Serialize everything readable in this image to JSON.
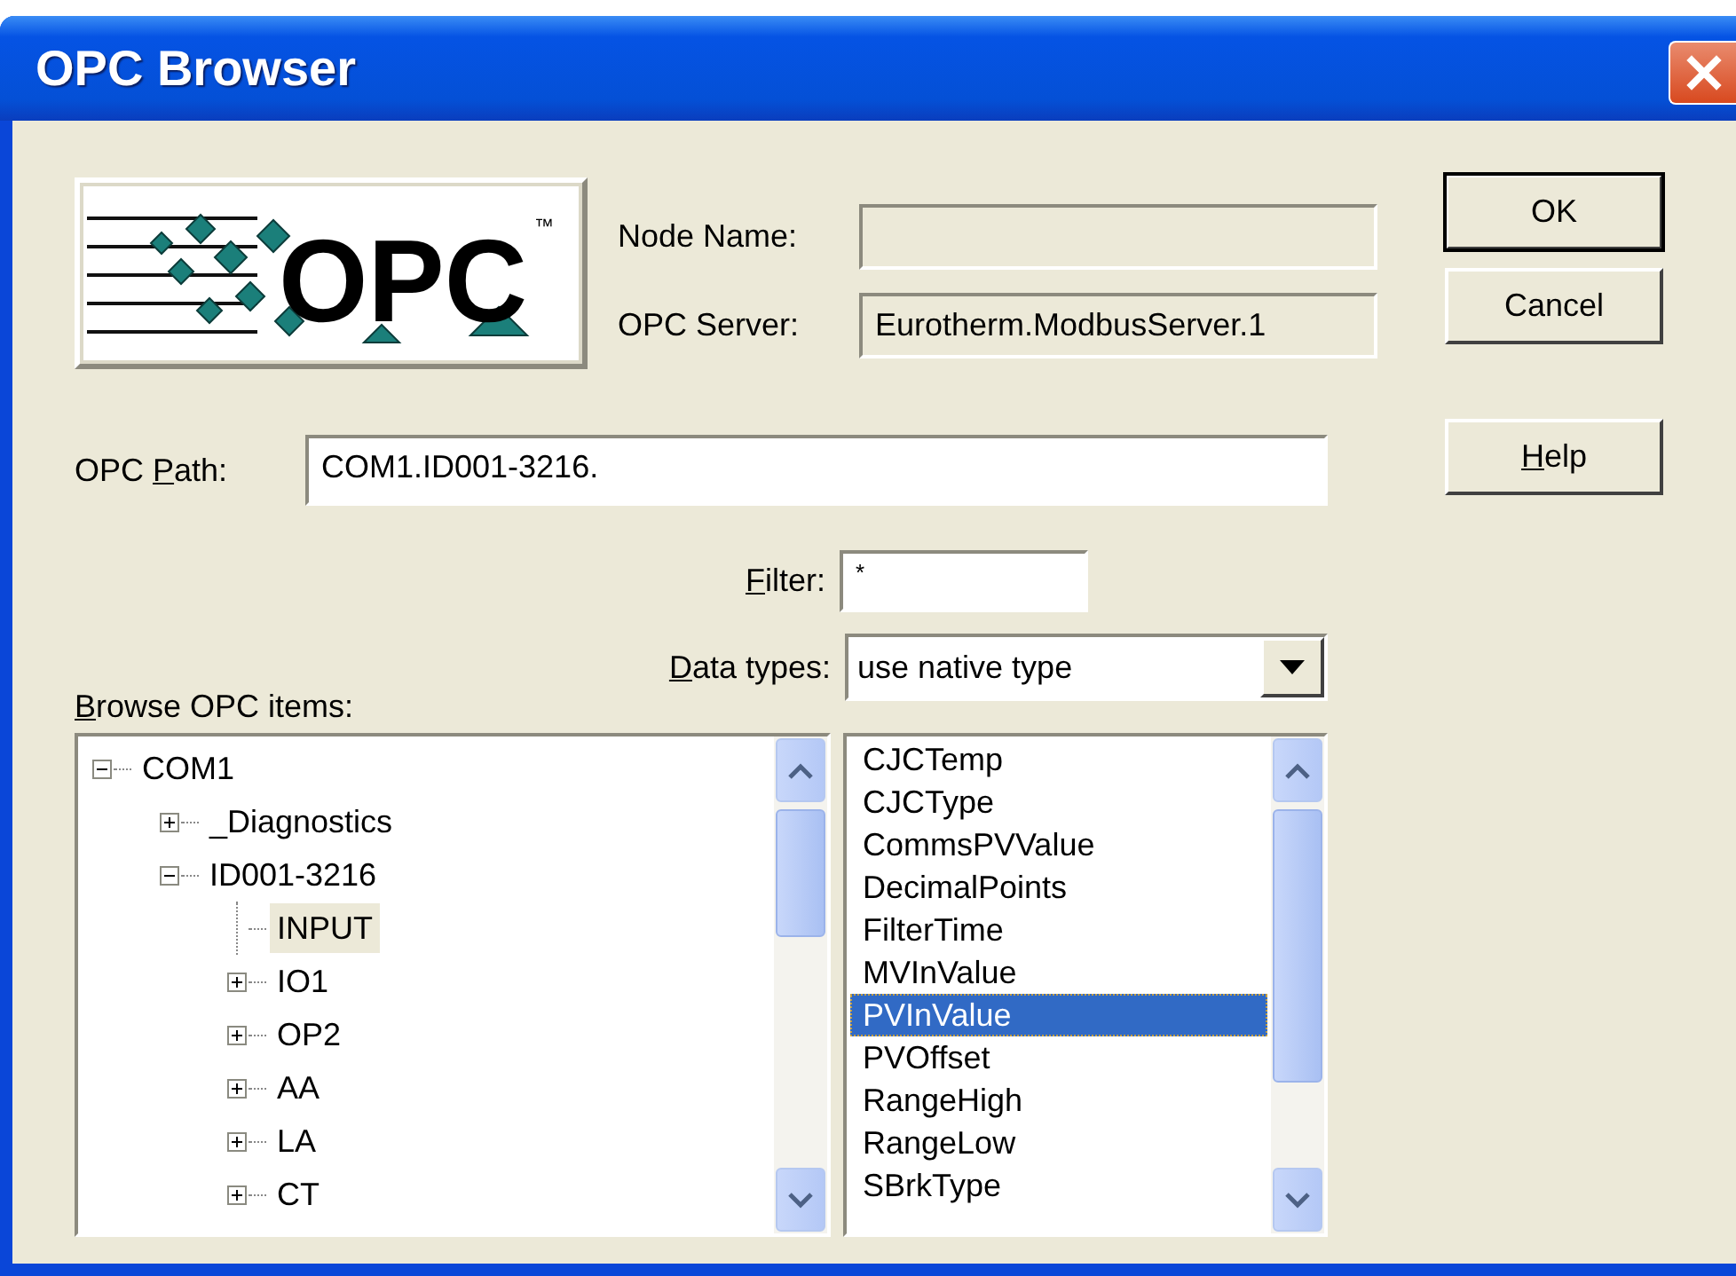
{
  "window": {
    "title": "OPC Browser"
  },
  "logo": {
    "text": "OPC",
    "mark": "™"
  },
  "node_name": {
    "label": {
      "before": "Node Name:"
    }
  },
  "opc_server": {
    "label": {
      "before": "OPC Server:"
    },
    "value": "Eurotherm.ModbusServer.1"
  },
  "opc_path": {
    "label": {
      "before": "OPC ",
      "key": "P",
      "after": "ath:"
    },
    "value": "COM1.ID001-3216."
  },
  "filter": {
    "label": {
      "key": "F",
      "after": "ilter:"
    },
    "value": "*"
  },
  "data_types": {
    "label": {
      "key": "D",
      "after": "ata types:"
    },
    "value": "use native type"
  },
  "browse_label": {
    "key": "B",
    "after": "rowse OPC items:"
  },
  "tree": [
    {
      "label": "COM1",
      "kind": "folder",
      "expanded": true,
      "selected": false,
      "children": [
        {
          "label": "_Diagnostics",
          "kind": "folder",
          "expanded": false,
          "selected": false
        },
        {
          "label": "ID001-3216",
          "kind": "folder",
          "expanded": true,
          "selected": false,
          "children": [
            {
              "label": "INPUT",
              "kind": "leaf",
              "selected": true
            },
            {
              "label": "IO1",
              "kind": "folder",
              "expanded": false,
              "selected": false
            },
            {
              "label": "OP2",
              "kind": "folder",
              "expanded": false,
              "selected": false
            },
            {
              "label": "AA",
              "kind": "folder",
              "expanded": false,
              "selected": false
            },
            {
              "label": "LA",
              "kind": "folder",
              "expanded": false,
              "selected": false
            },
            {
              "label": "CT",
              "kind": "folder",
              "expanded": false,
              "selected": false
            }
          ]
        }
      ]
    }
  ],
  "items": [
    {
      "label": "CJCTemp",
      "selected": false
    },
    {
      "label": "CJCType",
      "selected": false
    },
    {
      "label": "CommsPVValue",
      "selected": false
    },
    {
      "label": "DecimalPoints",
      "selected": false
    },
    {
      "label": "FilterTime",
      "selected": false
    },
    {
      "label": "MVInValue",
      "selected": false
    },
    {
      "label": "PVInValue",
      "selected": true
    },
    {
      "label": "PVOffset",
      "selected": false
    },
    {
      "label": "RangeHigh",
      "selected": false
    },
    {
      "label": "RangeLow",
      "selected": false
    },
    {
      "label": "SBrkType",
      "selected": false
    }
  ],
  "buttons": [
    {
      "kind": "default",
      "label": {
        "before": "OK"
      }
    },
    {
      "kind": "normal",
      "label": {
        "before": "Cancel"
      }
    },
    {
      "kind": "spaced",
      "label": {
        "key": "H",
        "after": "elp"
      }
    }
  ]
}
